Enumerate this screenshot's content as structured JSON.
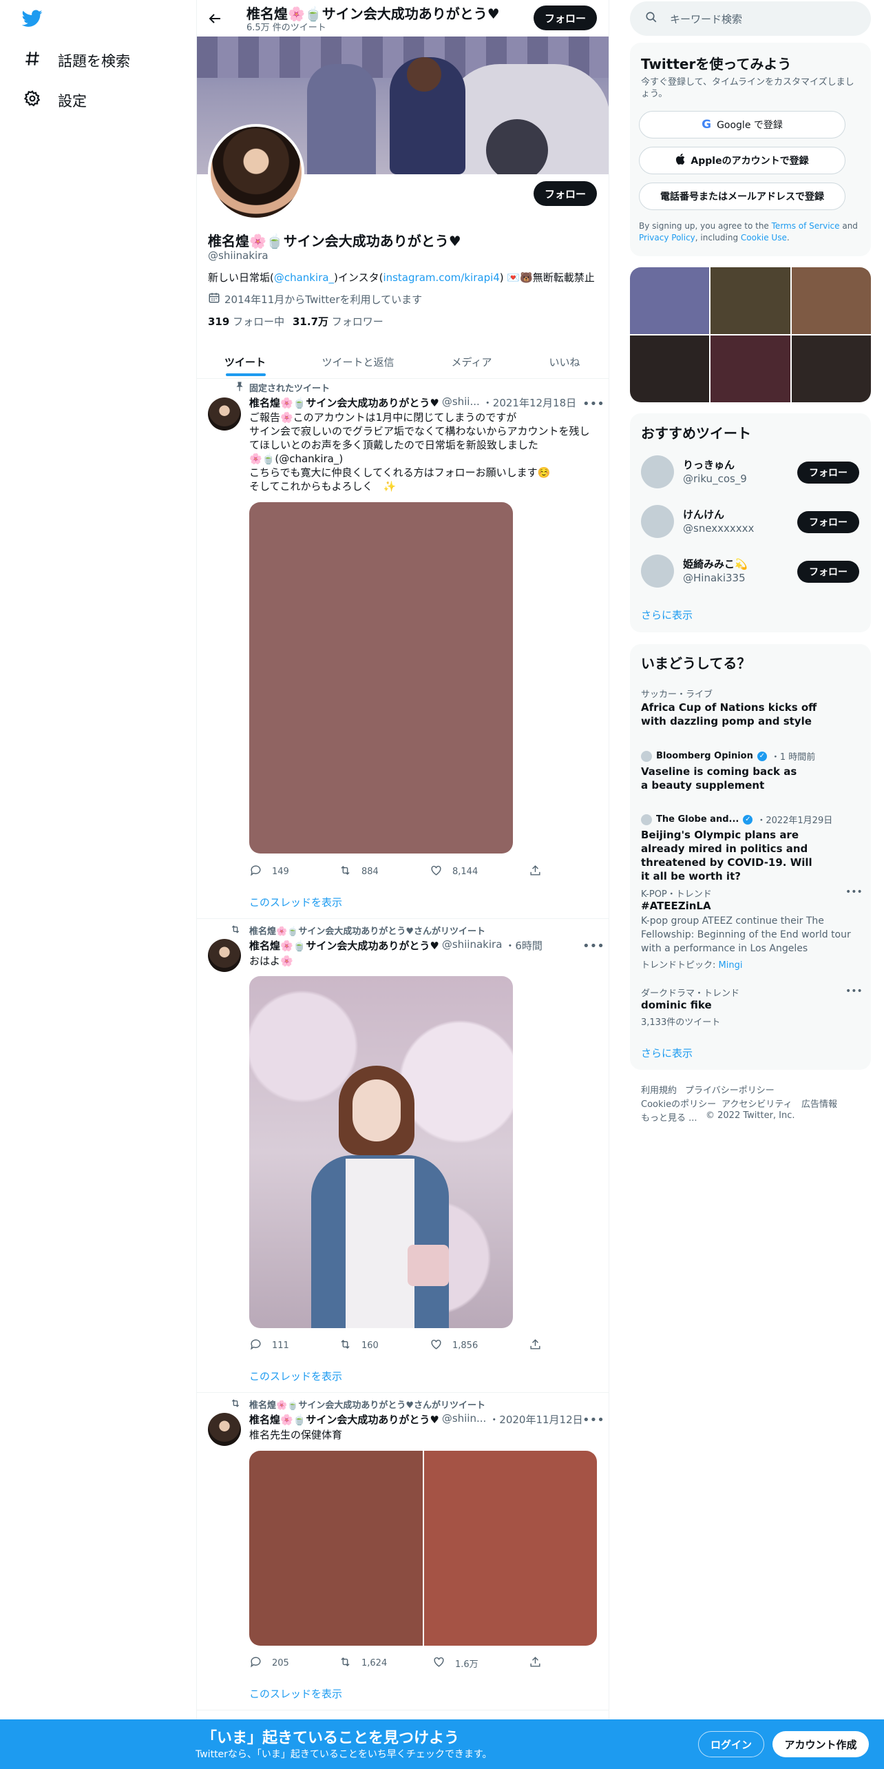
{
  "left_nav": {
    "explore_label": "話題を検索",
    "settings_label": "設定"
  },
  "header": {
    "name": "椎名煌🌸🍵サイン会大成功ありがとう♥",
    "tweet_count": "6.5万 件のツイート",
    "follow_label": "フォロー"
  },
  "profile": {
    "follow_label": "フォロー",
    "name": "椎名煌🌸🍵サイン会大成功ありがとう♥",
    "handle": "@shiinakira",
    "bio_pre": "新しい日常垢(",
    "bio_link1": "@chankira_",
    "bio_mid": ")インスタ(",
    "bio_link2": "instagram.com/kirapi4",
    "bio_post": ") 💌🐻無断転載禁止",
    "joined": "2014年11月からTwitterを利用しています",
    "following_count": "319",
    "following_label": "フォロー中",
    "followers_count": "31.7万",
    "followers_label": "フォロワー"
  },
  "tabs": [
    "ツイート",
    "ツイートと返信",
    "メディア",
    "いいね"
  ],
  "tweets": [
    {
      "context": "固定されたツイート",
      "name": "椎名煌🌸🍵サイン会大成功ありがとう♥",
      "handle": "@shii...",
      "time": "・2021年12月18日",
      "text_lines": [
        "ご報告🌸このアカウントは1月中に閉じてしまうのですが",
        "サイン会で寂しいのでグラビア垢でなくて構わないからアカウントを残し",
        "てほしいとのお声を多く頂戴したので日常垢を新設致しました",
        "🌸🍵(@chankira_)",
        "こちらでも寛大に仲良くしてくれる方はフォローお願いします☺️",
        "そしてこれからもよろしく　✨"
      ],
      "replies": "149",
      "retweets": "884",
      "likes": "8,144",
      "thread_label": "このスレッドを表示",
      "image_color": "#906462"
    },
    {
      "context": "椎名煌🌸🍵サイン会大成功ありがとう♥さんがリツイート",
      "name": "椎名煌🌸🍵サイン会大成功ありがとう♥",
      "handle": "@shiinakira",
      "time": "・6時間",
      "text_lines": [
        "おはよ🌸"
      ],
      "replies": "111",
      "retweets": "160",
      "likes": "1,856",
      "thread_label": "このスレッドを表示"
    },
    {
      "context": "椎名煌🌸🍵サイン会大成功ありがとう♥さんがリツイート",
      "name": "椎名煌🌸🍵サイン会大成功ありがとう♥",
      "handle": "@shiin...",
      "time": "・2020年11月12日",
      "text_lines": [
        "椎名先生の保健体育"
      ],
      "replies": "205",
      "retweets": "1,624",
      "likes": "1.6万",
      "thread_label": "このスレッドを表示",
      "image_colors": [
        "#8b4d41",
        "#a55345"
      ]
    }
  ],
  "right": {
    "search_placeholder": "キーワード検索",
    "signup_title": "Twitterを使ってみよう",
    "signup_sub": "今すぐ登録して、タイムラインをカスタマイズしましょう。",
    "google_btn": "Google で登録",
    "apple_btn": "Appleのアカウントで登録",
    "phone_btn": "電話番号またはメールアドレスで登録",
    "terms_pre": "By signing up, you agree to the ",
    "terms_link": "Terms of Service",
    "terms_and": " and ",
    "privacy_link": "Privacy Policy",
    "terms_mid": ", including ",
    "cookie_link": "Cookie Use",
    "terms_end": ".",
    "media_colors": [
      "#6a6c9e",
      "#4e4430",
      "#7e5a44",
      "#2a2322",
      "#4c2830",
      "#2e2624"
    ],
    "recommend_title": "おすすめツイート",
    "recommend": [
      {
        "name": "りっきゅん",
        "handle": "@riku_cos_9",
        "button": "フォロー"
      },
      {
        "name": "けんけん",
        "handle": "@snexxxxxxx",
        "button": "フォロー"
      },
      {
        "name": "姫綺みみこ💫",
        "handle": "@Hinaki335",
        "button": "フォロー"
      }
    ],
    "show_more": "さらに表示",
    "trends_title": "いまどうしてる？",
    "trends": {
      "t1_meta": "サッカー・ライブ",
      "t1_title": "Africa Cup of Nations kicks off with dazzling pomp and style",
      "t2_source": "Bloomberg Opinion",
      "t2_time": "・1 時間前",
      "t2_title": "Vaseline is coming back as a beauty supplement",
      "t3_source": "The Globe and...",
      "t3_time": "・2022年1月29日",
      "t3_title": "Beijing's Olympic plans are already mired in politics and threatened by COVID-19. Will it all be worth it?",
      "t4_meta": "K-POP・トレンド",
      "t4_title": "#ATEEZinLA",
      "t4_desc": "K-pop group ATEEZ continue their The Fellowship: Beginning of the End world tour with a performance in Los Angeles",
      "t4_topic_label": "トレンドトピック: ",
      "t4_topic": "Mingi",
      "t5_meta": "ダークドラマ・トレンド",
      "t5_title": "dominic fike",
      "t5_count": "3,133件のツイート"
    },
    "trends_more": "さらに表示",
    "footer": [
      "利用規約",
      "プライバシーポリシー",
      "Cookieのポリシー",
      "アクセシビリティ",
      "広告情報",
      "もっと見る ...",
      "© 2022 Twitter, Inc."
    ]
  },
  "bottom_bar": {
    "title": "「いま」起きていることを見つけよう",
    "subtitle": "Twitterなら、「いま」起きていることをいち早くチェックできます。",
    "login": "ログイン",
    "signup": "アカウント作成",
    "color": "#1d9bf0"
  }
}
